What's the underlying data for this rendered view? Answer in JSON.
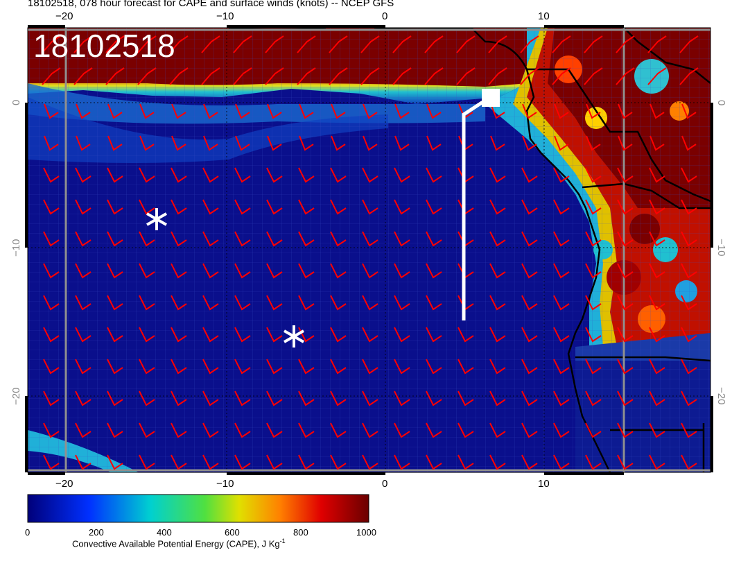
{
  "header": {
    "title": "18102518, 078 hour forecast for CAPE and surface winds (knots) -- NCEP GFS"
  },
  "map": {
    "stamp": "18102518",
    "lon_ticks_bottom": [
      "−20",
      "−10",
      "0",
      "10"
    ],
    "lon_ticks_top": [
      "−20",
      "−10",
      "0",
      "10"
    ],
    "lat_ticks_left": [
      "0",
      "−10",
      "−20"
    ],
    "lat_ticks_right": [
      "0",
      "−10",
      "−20"
    ],
    "colors": {
      "ocean_low": "#0a0f8c",
      "mid": "#00a0c8",
      "high": "#7a0000",
      "wind_barb": "#ff0000",
      "markers": "#ffffff"
    },
    "markers": [
      "asterisk",
      "asterisk",
      "ship-track"
    ]
  },
  "colorbar": {
    "labels": [
      "0",
      "200",
      "400",
      "600",
      "800",
      "1000"
    ],
    "title": "Convective Available Potential Energy (CAPE), J Kg",
    "title_sup": "-1",
    "stops": [
      "#00007a",
      "#0040ff",
      "#00d0d0",
      "#40e040",
      "#e0e000",
      "#ff8000",
      "#e00000",
      "#700000"
    ]
  }
}
